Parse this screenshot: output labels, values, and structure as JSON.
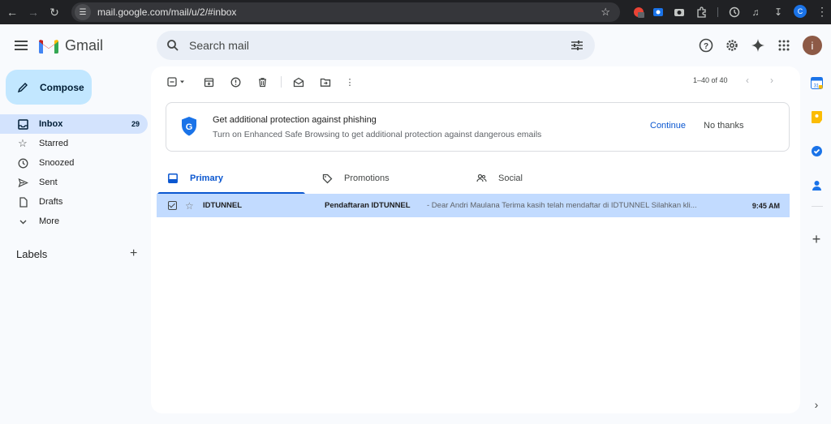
{
  "browser": {
    "url": "mail.google.com/mail/u/2/#inbox",
    "profile_initial": "C",
    "ext_badge": "1"
  },
  "app": {
    "name": "Gmail",
    "search_placeholder": "Search mail",
    "avatar_initial": "i"
  },
  "compose": {
    "label": "Compose"
  },
  "nav": [
    {
      "label": "Inbox",
      "icon": "inbox-icon",
      "count": "29",
      "active": true
    },
    {
      "label": "Starred",
      "icon": "star-icon"
    },
    {
      "label": "Snoozed",
      "icon": "clock-icon"
    },
    {
      "label": "Sent",
      "icon": "send-icon"
    },
    {
      "label": "Drafts",
      "icon": "draft-icon"
    },
    {
      "label": "More",
      "icon": "chevron-down-icon"
    }
  ],
  "labels": {
    "heading": "Labels"
  },
  "toolbar": {
    "pagination": "1–40 of 40"
  },
  "banner": {
    "title": "Get additional protection against phishing",
    "subtitle": "Turn on Enhanced Safe Browsing to get additional protection against dangerous emails",
    "continue": "Continue",
    "no_thanks": "No thanks"
  },
  "tabs": [
    {
      "label": "Primary",
      "icon": "inbox-tab-icon",
      "active": true
    },
    {
      "label": "Promotions",
      "icon": "tag-icon"
    },
    {
      "label": "Social",
      "icon": "people-icon"
    }
  ],
  "emails": [
    {
      "sender": "IDTUNNEL",
      "subject": "Pendaftaran IDTUNNEL",
      "snippet": " - Dear Andri Maulana Terima kasih telah mendaftar di IDTUNNEL Silahkan kli...",
      "time": "9:45 AM",
      "selected": true
    }
  ],
  "colors": {
    "accent": "#0b57d0",
    "compose_bg": "#c2e7ff",
    "selected_row": "#c2dbff",
    "nav_active": "#d3e3fd"
  }
}
